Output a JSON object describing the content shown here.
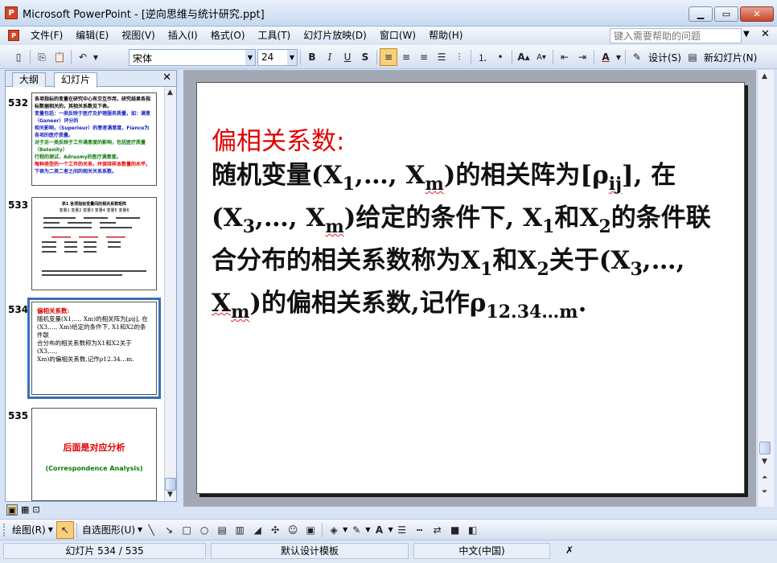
{
  "window": {
    "title": "Microsoft PowerPoint - [逆向思维与统计研究.ppt]",
    "app_icon": "powerpoint-icon"
  },
  "menu": {
    "items": [
      "文件(F)",
      "编辑(E)",
      "视图(V)",
      "插入(I)",
      "格式(O)",
      "工具(T)",
      "幻灯片放映(D)",
      "窗口(W)",
      "帮助(H)"
    ],
    "help_placeholder": "键入需要帮助的问题"
  },
  "toolbar": {
    "font_name": "宋体",
    "font_size": "24",
    "design_label": "设计(S)",
    "new_slide_label": "新幻灯片(N)"
  },
  "pane": {
    "tabs": [
      "大纲",
      "幻灯片"
    ],
    "selected_tab": "幻灯片"
  },
  "thumbnails": [
    {
      "number": "532",
      "lines": [
        "各项指标的变量在研究中心有交互作用，研究结果各指标数据相关的，其相关系数见下表。",
        "变量包括：一类反映于医疗及护理服务质量，如：满意（Ganeer）评分的",
        "相关影响，（Superieur）的患者满意度，Fiance为各项的医疗质量。",
        "对于另一类反映于工作满意度的影响，包括医疗质量（Betenity）",
        "行程的测试，Adrasmy的医疗满意度。",
        "每种类型的一个工作的关系，并保持样本数量的水平。",
        "下表为二类二者之间的相关关系系数。"
      ]
    },
    {
      "number": "533",
      "lines": [
        "表1 各项指标变量间的相关系数矩阵",
        "变量1  变量2  变量3  变量4  变量5  变量6"
      ]
    },
    {
      "number": "534",
      "lines": [
        "偏相关系数:",
        "随机变量(X1,…, Xm)的相关阵为[ρij], 在",
        "(X3,…, Xm)给定的条件下, X1和X2的条件联",
        "合分布的相关系数称为X1和X2关于(X3,…,",
        "Xm)的偏相关系数,记作ρ12.34…m."
      ]
    },
    {
      "number": "535",
      "lines": [
        "后面是对应分析",
        "(Correspondence Analysis)"
      ]
    }
  ],
  "slide": {
    "heading": "偏相关系数:",
    "line1_a": "随机变量(X",
    "line1_b": "1",
    "line1_c": ",…, X",
    "line1_d": "m",
    "line1_e": ")的相关阵为[ρ",
    "line1_f": "ij",
    "line1_g": "], 在",
    "line2_a": "(X",
    "line2_b": "3",
    "line2_c": ",…, X",
    "line2_d": "m",
    "line2_e": ")给定的条件下, X",
    "line2_f": "1",
    "line2_g": "和X",
    "line2_h": "2",
    "line2_i": "的条件联",
    "line3_a": "合分布的相关系数称为X",
    "line3_b": "1",
    "line3_c": "和X",
    "line3_d": "2",
    "line3_e": "关于(X",
    "line3_f": "3",
    "line3_g": ",…,",
    "line4_a": "X",
    "line4_b": "m",
    "line4_c": ")的偏相关系数,记作ρ",
    "line4_d": "12.34…m",
    "line4_e": "."
  },
  "drawbar": {
    "draw_label": "绘图(R)",
    "autoshape_label": "自选图形(U)"
  },
  "status": {
    "slide_pos": "幻灯片 534 / 535",
    "template": "默认设计模板",
    "language": "中文(中国)"
  },
  "colors": {
    "heading": "#e10000",
    "accent": "#3a6fb6"
  }
}
